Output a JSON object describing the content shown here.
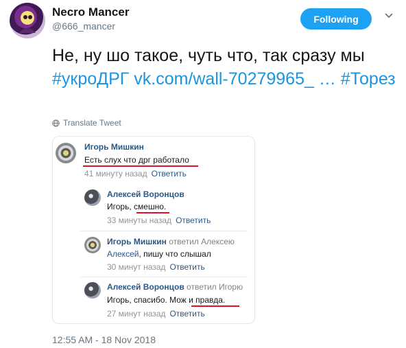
{
  "tweet": {
    "display_name": "Necro Mancer",
    "handle": "@666_mancer",
    "follow_label": "Following",
    "text_part1": "Не, ну шо такое, чуть что, так сразу мы ",
    "hashtag1": "#укроДРГ",
    "link": "vk.com/wall-70279965_ …",
    "hashtag2": "#Торез",
    "translate_label": "Translate Tweet",
    "timestamp": "12:55 AM - 18 Nov 2018",
    "accent_color": "#1da1f2"
  },
  "embedded_comments": [
    {
      "author": "Игорь Мишкин",
      "text": "Есть слух что дрг работало",
      "time": "41 минуту назад",
      "reply_label": "Ответить"
    },
    {
      "author": "Алексей Воронцов",
      "text_prefix": "Игорь,",
      "text_underlined": "смешно.",
      "time": "33 минуты назад",
      "reply_label": "Ответить"
    },
    {
      "author": "Игорь Мишкин",
      "replied_to": "ответил Алексею",
      "mention": "Алексей",
      "text": ", пишу что слышал",
      "time": "30 минут назад",
      "reply_label": "Ответить"
    },
    {
      "author": "Алексей Воронцов",
      "replied_to": "ответил Игорю",
      "text_prefix": "Игорь, спасибо.",
      "text_underlined": "Мож и правда.",
      "time": "27 минут назад",
      "reply_label": "Ответить"
    }
  ],
  "icons": {
    "globe": "globe-icon",
    "caret": "chevron-down-icon",
    "underline_color": "#e3102a"
  }
}
